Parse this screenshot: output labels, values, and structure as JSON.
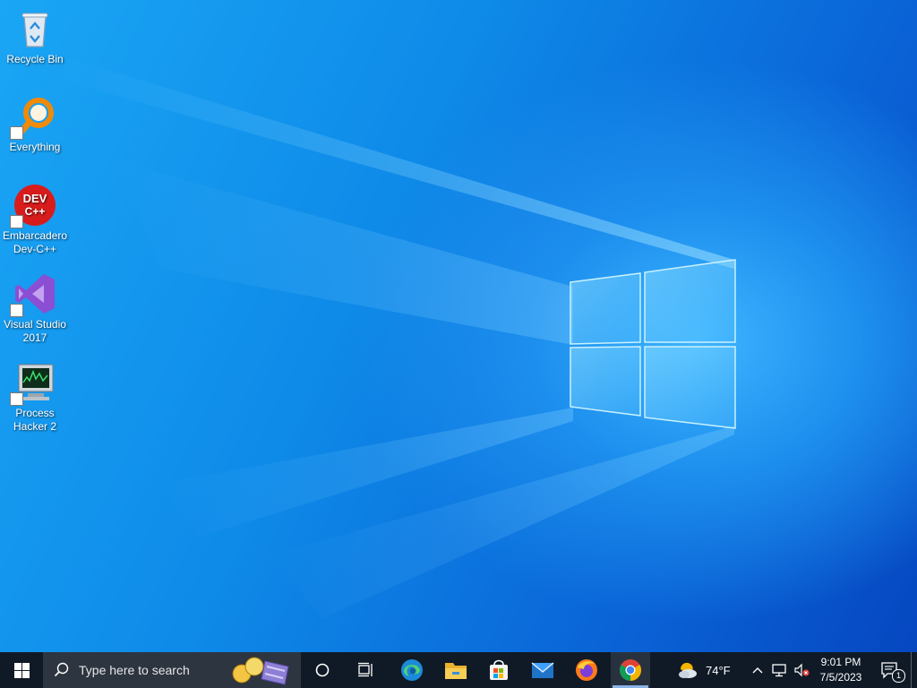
{
  "desktop": {
    "icons": [
      {
        "label": "Recycle Bin",
        "icon": "recycle-bin-icon",
        "shortcut": false
      },
      {
        "label": "Everything",
        "icon": "everything-search-icon",
        "shortcut": true
      },
      {
        "label": "Embarcadero Dev-C++",
        "icon": "dev-cpp-icon",
        "shortcut": true,
        "badge_text": "DEV\nC++"
      },
      {
        "label": "Visual Studio 2017",
        "icon": "visual-studio-icon",
        "shortcut": true
      },
      {
        "label": "Process Hacker 2",
        "icon": "process-hacker-icon",
        "shortcut": true
      }
    ],
    "accent": "#0b7ee8"
  },
  "taskbar": {
    "search_placeholder": "Type here to search",
    "apps": [
      {
        "name": "Microsoft Edge",
        "icon": "edge-icon"
      },
      {
        "name": "File Explorer",
        "icon": "folder-icon"
      },
      {
        "name": "Microsoft Store",
        "icon": "store-icon"
      },
      {
        "name": "Mail",
        "icon": "mail-icon"
      },
      {
        "name": "Firefox",
        "icon": "firefox-icon"
      },
      {
        "name": "Google Chrome",
        "icon": "chrome-icon",
        "active": true
      }
    ],
    "weather": {
      "temp": "74°F",
      "icon": "weather-partly-cloudy-icon"
    },
    "clock": {
      "time": "9:01 PM",
      "date": "7/5/2023"
    },
    "notifications": {
      "count": "1"
    },
    "background": "#101a26"
  }
}
